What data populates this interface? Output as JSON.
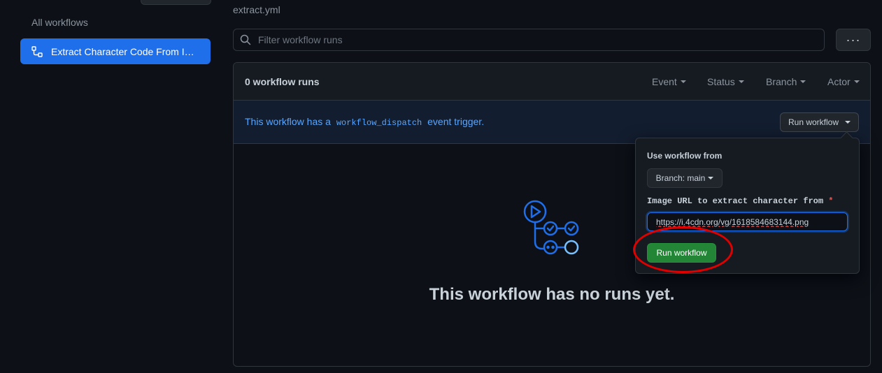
{
  "sidebar": {
    "all_workflows": "All workflows",
    "active_item": "Extract Character Code From I…"
  },
  "main": {
    "filename": "extract.yml",
    "filter_placeholder": "Filter workflow runs",
    "more_label": "···",
    "runs_count": "0 workflow runs",
    "filters": [
      "Event",
      "Status",
      "Branch",
      "Actor"
    ],
    "dispatch": {
      "prefix": "This workflow has a",
      "code": "workflow_dispatch",
      "suffix": "event trigger.",
      "button": "Run workflow"
    },
    "empty_message": "This workflow has no runs yet."
  },
  "popover": {
    "title": "Use workflow from",
    "branch": "Branch: main",
    "input_label": "Image URL to extract character from",
    "required_marker": "*",
    "input_value": "https://i.4cdn.org/vg/1618584683144.png",
    "run_button": "Run workflow"
  },
  "colors": {
    "background": "#0d1117",
    "accent": "#1f6feb",
    "link": "#58a6ff",
    "success": "#238636",
    "annotation": "#e00000"
  },
  "icons": [
    "workflow-icon",
    "search-icon",
    "actions-blankslate-icon"
  ]
}
